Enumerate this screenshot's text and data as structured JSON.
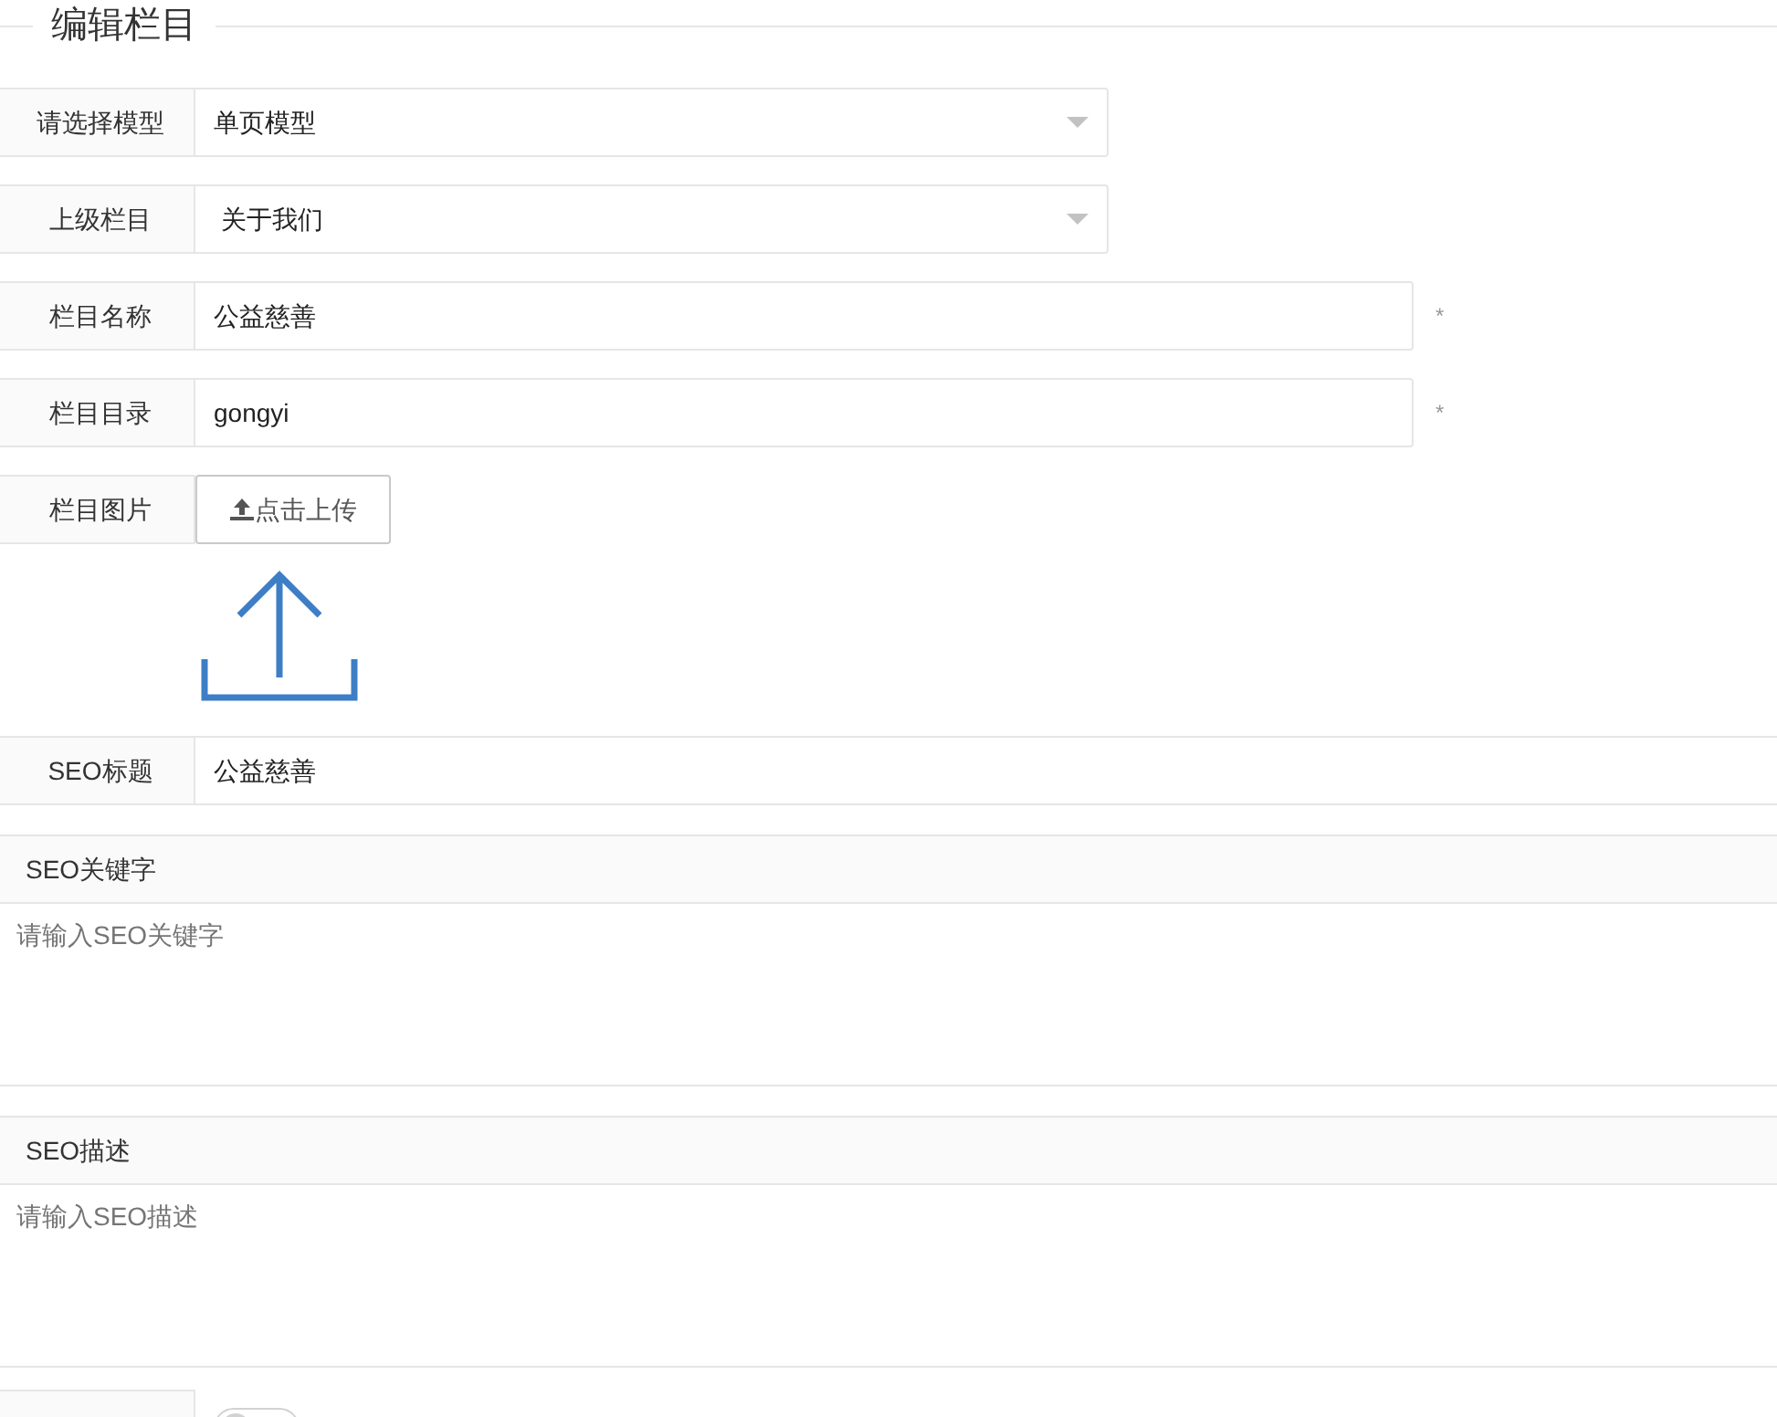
{
  "legend": "编辑栏目",
  "rows": [
    {
      "kind": "select",
      "label": "请选择模型",
      "value": "单页模型"
    },
    {
      "kind": "select",
      "label": "上级栏目",
      "value": "关于我们"
    },
    {
      "kind": "input",
      "label": "栏目名称",
      "value": "公益慈善",
      "required_mark": "*"
    },
    {
      "kind": "input",
      "label": "栏目目录",
      "value": "gongyi",
      "required_mark": "*"
    },
    {
      "kind": "upload",
      "label": "栏目图片",
      "button": "点击上传"
    },
    {
      "kind": "wide",
      "label": "SEO标题",
      "value": "公益慈善"
    },
    {
      "kind": "textarea",
      "label": "SEO关键字",
      "placeholder": "请输入SEO关键字"
    },
    {
      "kind": "textarea",
      "label": "SEO描述",
      "placeholder": "请输入SEO描述"
    },
    {
      "kind": "switch",
      "on": false
    }
  ]
}
